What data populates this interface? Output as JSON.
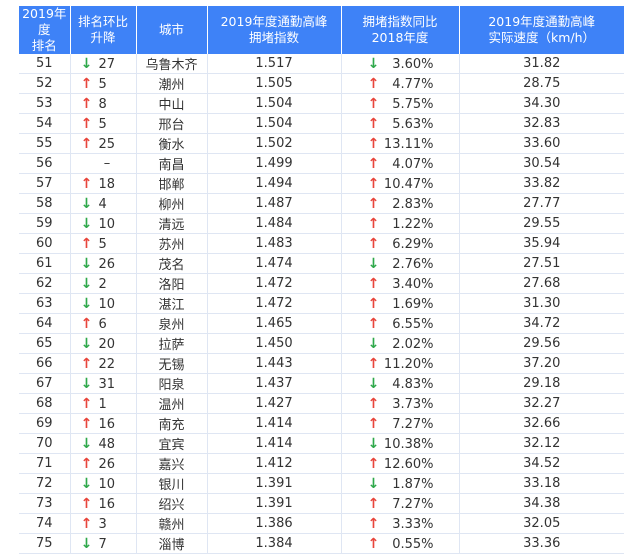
{
  "headers": [
    {
      "line1": "2019年度",
      "line2": "排名"
    },
    {
      "line1": "排名环比",
      "line2": "升降"
    },
    {
      "line1": "城市",
      "line2": ""
    },
    {
      "line1": "2019年度通勤高峰",
      "line2": "拥堵指数"
    },
    {
      "line1": "拥堵指数同比",
      "line2": "2018年度"
    },
    {
      "line1": "2019年度通勤高峰",
      "line2": "实际速度（km/h）"
    }
  ],
  "colors": {
    "header_bg": "#3e82f7",
    "up": "#e8453c",
    "down": "#2ea84a"
  },
  "rows": [
    {
      "rank": "51",
      "change_dir": "down",
      "change": "27",
      "city": "乌鲁木齐",
      "index": "1.517",
      "yoy_dir": "down",
      "yoy": "3.60%",
      "speed": "31.82"
    },
    {
      "rank": "52",
      "change_dir": "up",
      "change": "5",
      "city": "潮州",
      "index": "1.505",
      "yoy_dir": "up",
      "yoy": "4.77%",
      "speed": "28.75"
    },
    {
      "rank": "53",
      "change_dir": "up",
      "change": "8",
      "city": "中山",
      "index": "1.504",
      "yoy_dir": "up",
      "yoy": "5.75%",
      "speed": "34.30"
    },
    {
      "rank": "54",
      "change_dir": "up",
      "change": "5",
      "city": "邢台",
      "index": "1.504",
      "yoy_dir": "up",
      "yoy": "5.63%",
      "speed": "32.83"
    },
    {
      "rank": "55",
      "change_dir": "up",
      "change": "25",
      "city": "衡水",
      "index": "1.502",
      "yoy_dir": "up",
      "yoy": "13.11%",
      "speed": "33.60"
    },
    {
      "rank": "56",
      "change_dir": "none",
      "change": "–",
      "city": "南昌",
      "index": "1.499",
      "yoy_dir": "up",
      "yoy": "4.07%",
      "speed": "30.54"
    },
    {
      "rank": "57",
      "change_dir": "up",
      "change": "18",
      "city": "邯郸",
      "index": "1.494",
      "yoy_dir": "up",
      "yoy": "10.47%",
      "speed": "33.82"
    },
    {
      "rank": "58",
      "change_dir": "down",
      "change": "4",
      "city": "柳州",
      "index": "1.487",
      "yoy_dir": "up",
      "yoy": "2.83%",
      "speed": "27.77"
    },
    {
      "rank": "59",
      "change_dir": "down",
      "change": "10",
      "city": "清远",
      "index": "1.484",
      "yoy_dir": "up",
      "yoy": "1.22%",
      "speed": "29.55"
    },
    {
      "rank": "60",
      "change_dir": "up",
      "change": "5",
      "city": "苏州",
      "index": "1.483",
      "yoy_dir": "up",
      "yoy": "6.29%",
      "speed": "35.94"
    },
    {
      "rank": "61",
      "change_dir": "down",
      "change": "26",
      "city": "茂名",
      "index": "1.474",
      "yoy_dir": "down",
      "yoy": "2.76%",
      "speed": "27.51"
    },
    {
      "rank": "62",
      "change_dir": "down",
      "change": "2",
      "city": "洛阳",
      "index": "1.472",
      "yoy_dir": "up",
      "yoy": "3.40%",
      "speed": "27.68"
    },
    {
      "rank": "63",
      "change_dir": "down",
      "change": "10",
      "city": "湛江",
      "index": "1.472",
      "yoy_dir": "up",
      "yoy": "1.69%",
      "speed": "31.30"
    },
    {
      "rank": "64",
      "change_dir": "up",
      "change": "6",
      "city": "泉州",
      "index": "1.465",
      "yoy_dir": "up",
      "yoy": "6.55%",
      "speed": "34.72"
    },
    {
      "rank": "65",
      "change_dir": "down",
      "change": "20",
      "city": "拉萨",
      "index": "1.450",
      "yoy_dir": "down",
      "yoy": "2.02%",
      "speed": "29.56"
    },
    {
      "rank": "66",
      "change_dir": "up",
      "change": "22",
      "city": "无锡",
      "index": "1.443",
      "yoy_dir": "up",
      "yoy": "11.20%",
      "speed": "37.20"
    },
    {
      "rank": "67",
      "change_dir": "down",
      "change": "31",
      "city": "阳泉",
      "index": "1.437",
      "yoy_dir": "down",
      "yoy": "4.83%",
      "speed": "29.18"
    },
    {
      "rank": "68",
      "change_dir": "up",
      "change": "1",
      "city": "温州",
      "index": "1.427",
      "yoy_dir": "up",
      "yoy": "3.73%",
      "speed": "32.27"
    },
    {
      "rank": "69",
      "change_dir": "up",
      "change": "16",
      "city": "南充",
      "index": "1.414",
      "yoy_dir": "up",
      "yoy": "7.27%",
      "speed": "32.66"
    },
    {
      "rank": "70",
      "change_dir": "down",
      "change": "48",
      "city": "宜宾",
      "index": "1.414",
      "yoy_dir": "down",
      "yoy": "10.38%",
      "speed": "32.12"
    },
    {
      "rank": "71",
      "change_dir": "up",
      "change": "26",
      "city": "嘉兴",
      "index": "1.412",
      "yoy_dir": "up",
      "yoy": "12.60%",
      "speed": "34.52"
    },
    {
      "rank": "72",
      "change_dir": "down",
      "change": "10",
      "city": "银川",
      "index": "1.391",
      "yoy_dir": "down",
      "yoy": "1.87%",
      "speed": "33.18"
    },
    {
      "rank": "73",
      "change_dir": "up",
      "change": "16",
      "city": "绍兴",
      "index": "1.391",
      "yoy_dir": "up",
      "yoy": "7.27%",
      "speed": "34.38"
    },
    {
      "rank": "74",
      "change_dir": "up",
      "change": "3",
      "city": "赣州",
      "index": "1.386",
      "yoy_dir": "up",
      "yoy": "3.33%",
      "speed": "32.05"
    },
    {
      "rank": "75",
      "change_dir": "down",
      "change": "7",
      "city": "淄博",
      "index": "1.384",
      "yoy_dir": "up",
      "yoy": "0.55%",
      "speed": "33.36"
    }
  ]
}
